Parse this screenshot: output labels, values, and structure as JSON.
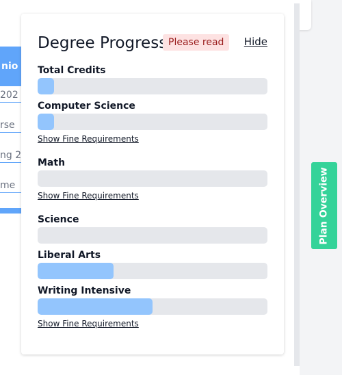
{
  "background": {
    "left_strip": {
      "header_fragment": "nio",
      "field_fragments": [
        "202",
        "rse",
        "ng 2",
        "me"
      ]
    }
  },
  "panel": {
    "title": "Degree Progress",
    "badge": "Please read",
    "hide_label": "Hide",
    "requirements": [
      {
        "label": "Total Credits",
        "progress": 0.07,
        "fine_link": ""
      },
      {
        "label": "Computer Science",
        "progress": 0.07,
        "fine_link": "Show Fine Requirements"
      },
      {
        "label": "Math",
        "progress": 0,
        "fine_link": "Show Fine Requirements"
      },
      {
        "label": "Science",
        "progress": 0,
        "fine_link": ""
      },
      {
        "label": "Liberal Arts",
        "progress": 0.33,
        "fine_link": ""
      },
      {
        "label": "Writing Intensive",
        "progress": 0.5,
        "fine_link": "Show Fine Requirements"
      }
    ]
  },
  "side_tab": {
    "label": "Plan Overview"
  },
  "colors": {
    "progress_fill": "#93c5fd",
    "progress_track": "#e5e7eb",
    "badge_bg": "#fde2e2",
    "side_tab_bg": "#34d399",
    "app_accent": "#60a5fa"
  }
}
